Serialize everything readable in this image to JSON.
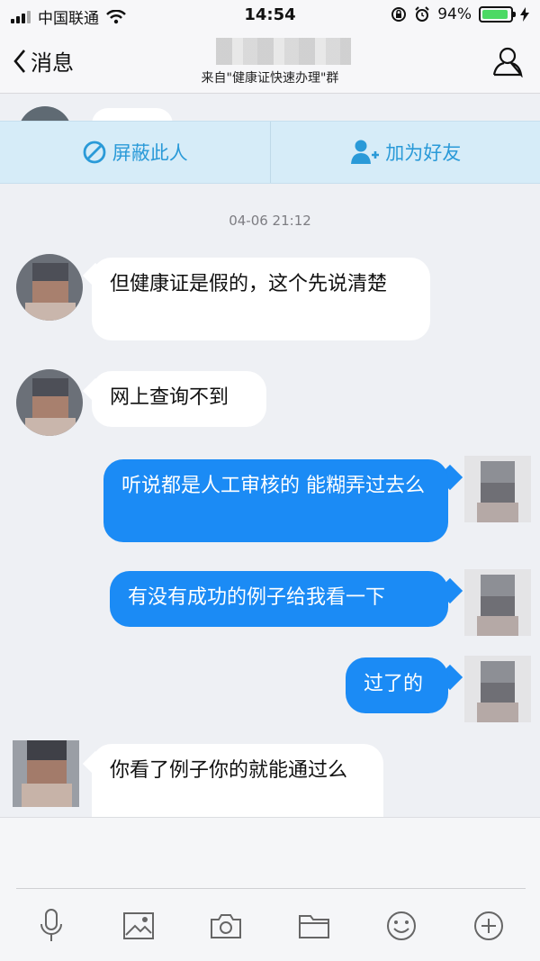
{
  "status_bar": {
    "carrier": "中国联通",
    "time": "14:54",
    "battery_percent": "94%",
    "battery_level": 0.94
  },
  "nav": {
    "back_label": "消息",
    "subtitle": "来自\"健康证快速办理\"群"
  },
  "actions": {
    "block_label": "屏蔽此人",
    "add_friend_label": "加为好友"
  },
  "timestamp": "04-06 21:12",
  "messages": [
    {
      "side": "in",
      "text": "但健康证是假的，这个先说清楚"
    },
    {
      "side": "in",
      "text": "网上查询不到"
    },
    {
      "side": "out",
      "text": "听说都是人工审核的 能糊弄过去么"
    },
    {
      "side": "out",
      "text": "有没有成功的例子给我看一下"
    },
    {
      "side": "out",
      "text": "过了的"
    },
    {
      "side": "in",
      "text": "你看了例子你的就能通过么"
    }
  ],
  "toolbar": [
    "microphone-icon",
    "image-icon",
    "camera-icon",
    "folder-icon",
    "emoji-icon",
    "plus-icon"
  ],
  "colors": {
    "accent": "#2a9ad8",
    "outgoing_bubble": "#1b8bf5",
    "action_bar": "#d6ecf8",
    "background": "#eef0f4"
  }
}
